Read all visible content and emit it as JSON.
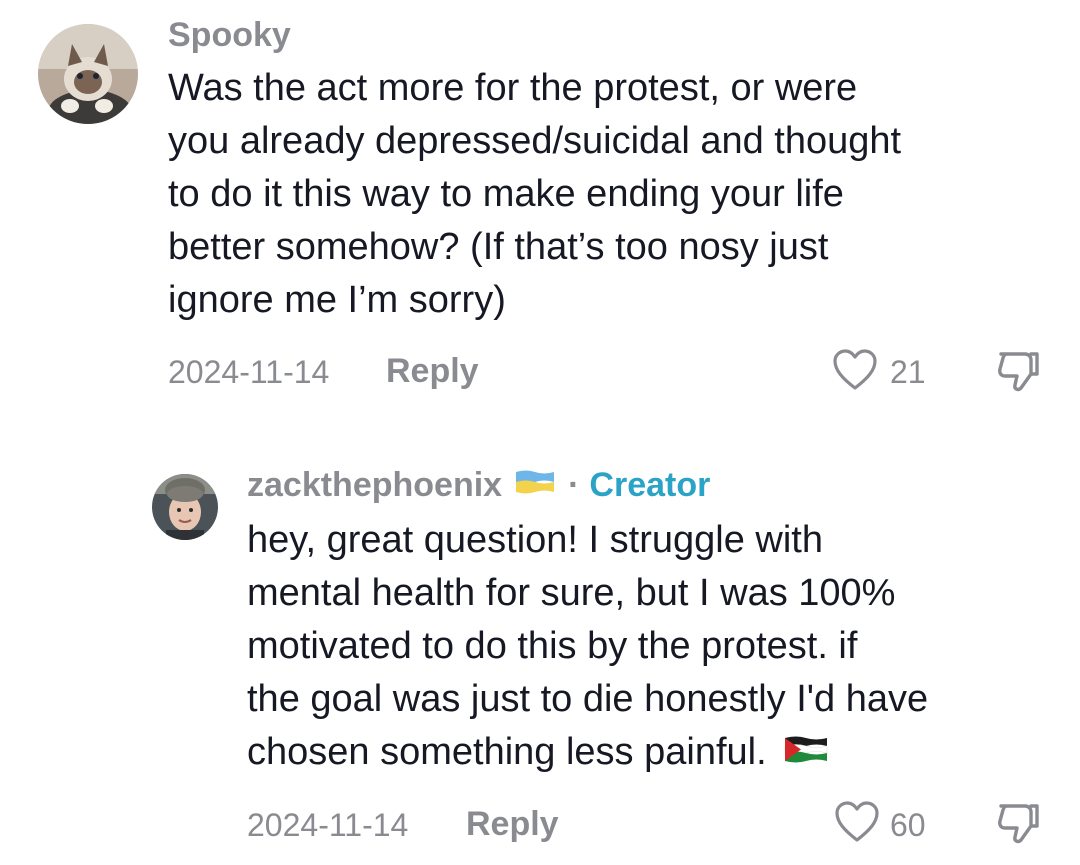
{
  "comments": [
    {
      "username": "Spooky",
      "text_lines": [
        "Was the act more for the protest, or were",
        "you already depressed/suicidal and thought",
        "to do it this way to make ending your life",
        "better somehow? (If that’s too nosy just",
        "ignore me I’m sorry)"
      ],
      "date": "2024-11-14",
      "reply_label": "Reply",
      "likes": "21"
    },
    {
      "username": "zackthephoenix",
      "badge_separator": "·",
      "badge": "Creator",
      "text_lines": [
        "hey, great question! I struggle with",
        "mental health for sure, but I was 100%",
        "motivated to do this by the protest. if",
        "the goal was just to die honestly I'd have",
        "chosen something less painful."
      ],
      "date": "2024-11-14",
      "reply_label": "Reply",
      "likes": "60"
    }
  ],
  "icons": {
    "like": "heart-outline-icon",
    "dislike": "thumbs-down-icon",
    "flag_ukraine": "ukraine-flag-icon",
    "flag_palestine": "palestine-flag-icon"
  },
  "colors": {
    "username": "#8a8b91",
    "text": "#161823",
    "creator": "#2aa3c7"
  }
}
